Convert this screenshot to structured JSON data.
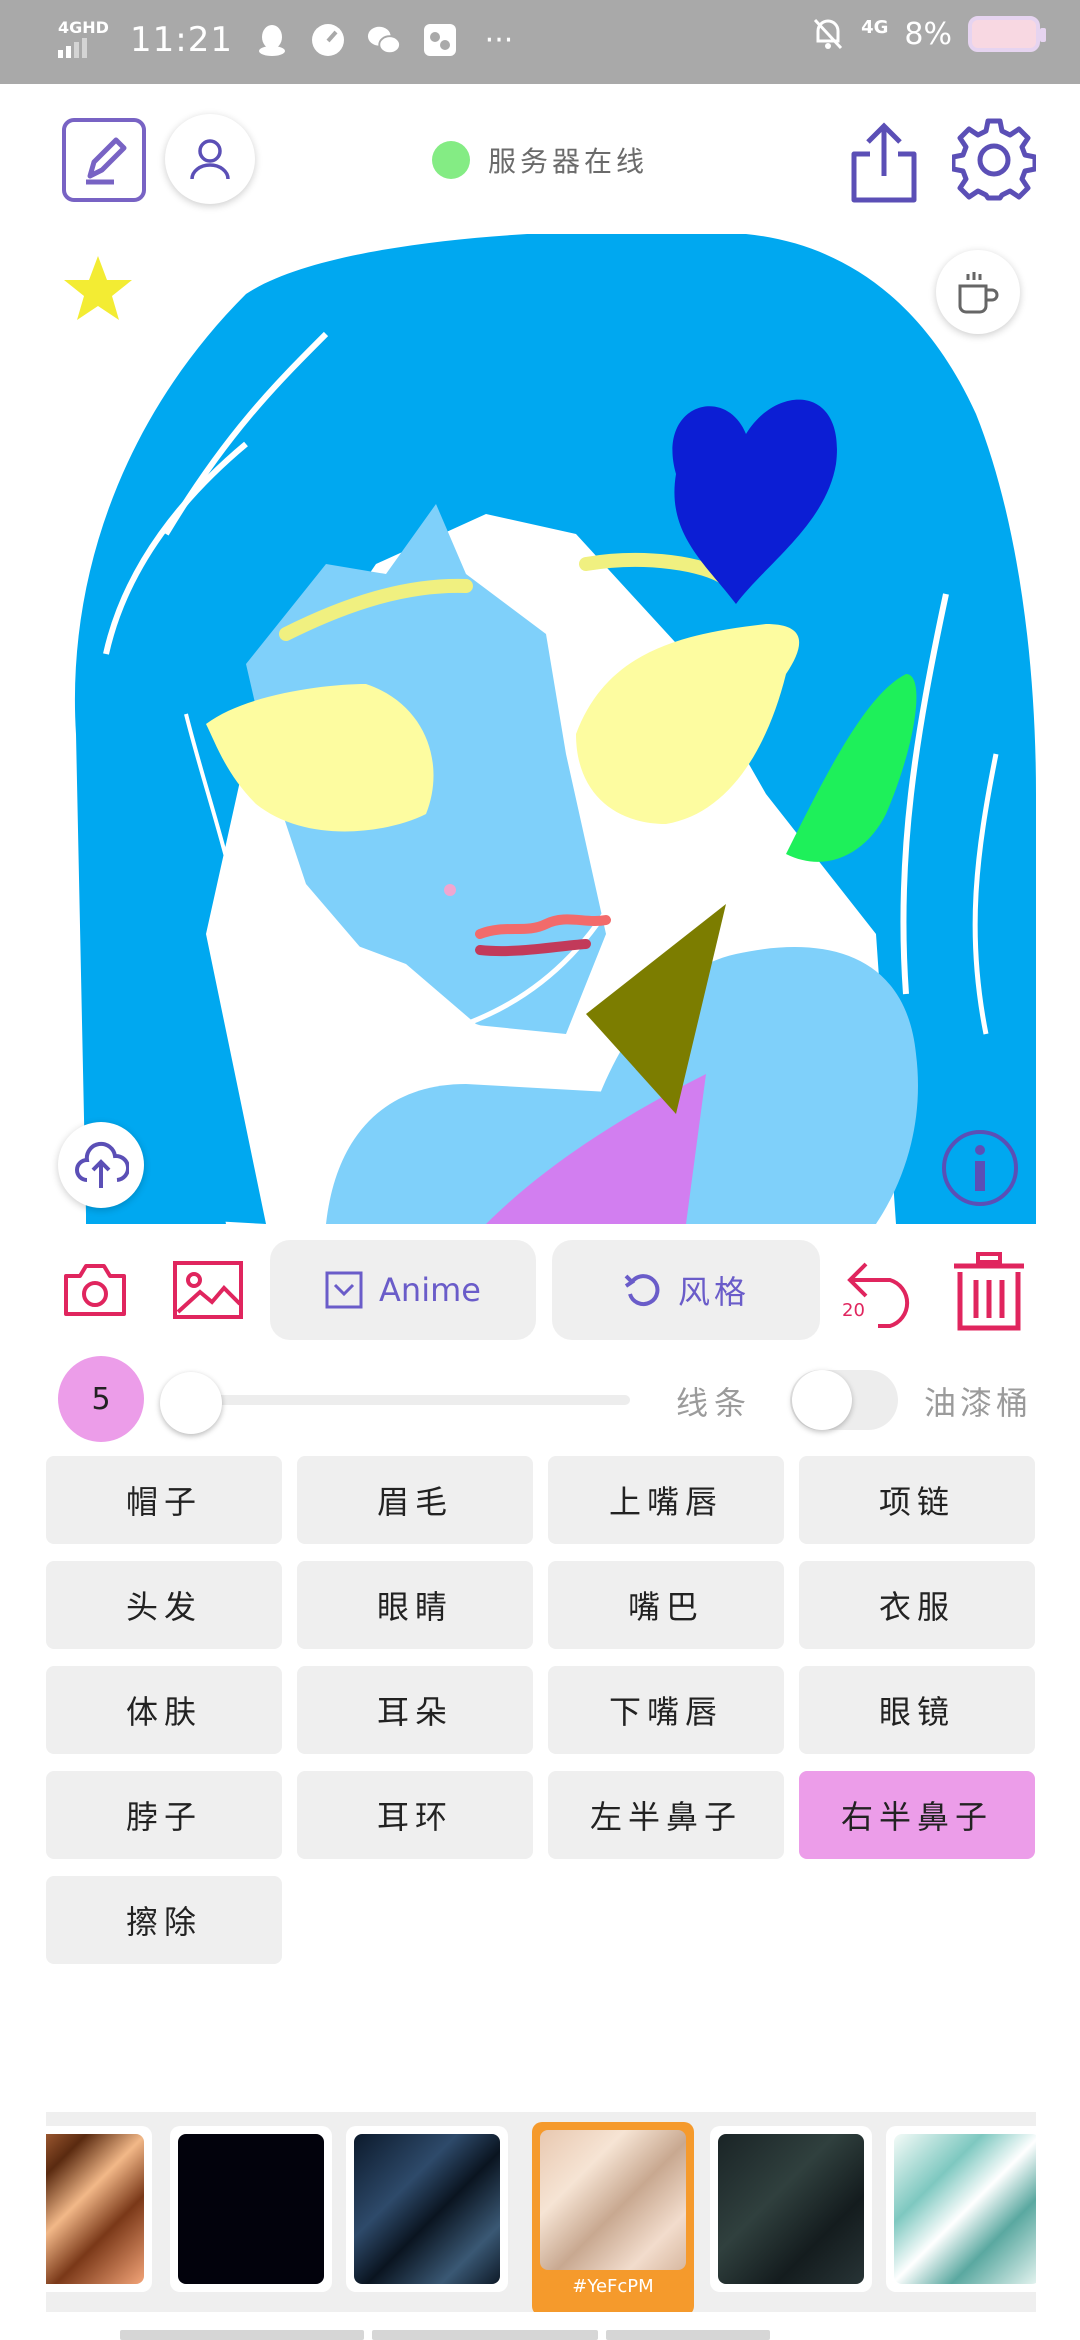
{
  "status_bar": {
    "network": "4GHD",
    "time": "11:21",
    "network_right": "4G",
    "battery": "8%",
    "icons": [
      "qq-icon",
      "speedometer-icon",
      "wechat-icon",
      "gallery-icon",
      "more-dots-icon",
      "mute-bell-icon"
    ]
  },
  "header": {
    "server_status": "服务器在线",
    "server_status_color": "#84ec84",
    "accent": "#7863c4"
  },
  "toolbar": {
    "anime_label": "Anime",
    "style_label": "风格",
    "undo_count": "20",
    "danger_color": "#e0255e"
  },
  "brush": {
    "size": "5",
    "slider_level": 0.0,
    "line_label": "线条",
    "bucket_label": "油漆桶",
    "bucket_enabled": false
  },
  "parts": [
    {
      "label": "帽子",
      "selected": false
    },
    {
      "label": "眉毛",
      "selected": false
    },
    {
      "label": "上嘴唇",
      "selected": false
    },
    {
      "label": "项链",
      "selected": false
    },
    {
      "label": "头发",
      "selected": false
    },
    {
      "label": "眼睛",
      "selected": false
    },
    {
      "label": "嘴巴",
      "selected": false
    },
    {
      "label": "衣服",
      "selected": false
    },
    {
      "label": "体肤",
      "selected": false
    },
    {
      "label": "耳朵",
      "selected": false
    },
    {
      "label": "下嘴唇",
      "selected": false
    },
    {
      "label": "眼镜",
      "selected": false
    },
    {
      "label": "脖子",
      "selected": false
    },
    {
      "label": "耳环",
      "selected": false
    },
    {
      "label": "左半鼻子",
      "selected": false
    },
    {
      "label": "右半鼻子",
      "selected": true
    },
    {
      "label": "擦除",
      "selected": false
    }
  ],
  "swatches": {
    "selected_label": "#YeFcPM",
    "selected_color": "#f59a2c"
  }
}
